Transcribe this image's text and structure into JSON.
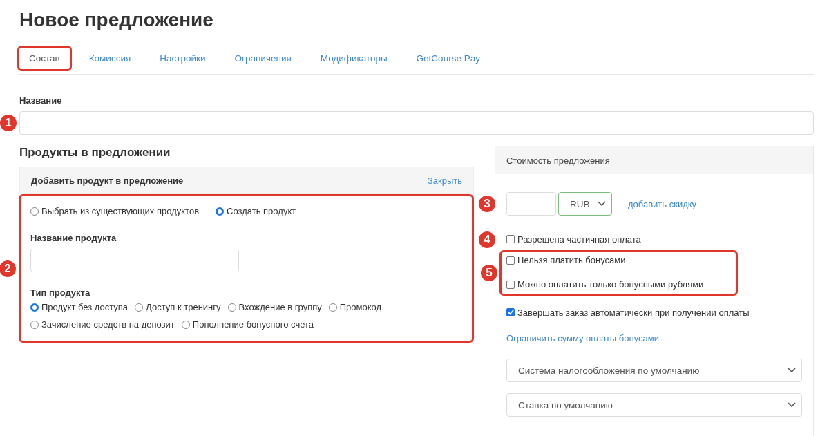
{
  "title": "Новое предложение",
  "tabs": [
    {
      "label": "Состав",
      "selected": true,
      "highlighted": true
    },
    {
      "label": "Комиссия",
      "selected": false,
      "highlighted": false
    },
    {
      "label": "Настройки",
      "selected": false,
      "highlighted": false
    },
    {
      "label": "Ограничения",
      "selected": false,
      "highlighted": false
    },
    {
      "label": "Модификаторы",
      "selected": false,
      "highlighted": false
    },
    {
      "label": "GetCourse Pay",
      "selected": false,
      "highlighted": false
    }
  ],
  "name_field": {
    "label": "Название",
    "marker": "1"
  },
  "products": {
    "heading": "Продукты в предложении",
    "panel_title": "Добавить продукт в предложение",
    "close_link": "Закрыть",
    "marker": "2",
    "highlighted": true,
    "source_options": [
      {
        "label": "Выбрать из существующих продуктов",
        "selected": false
      },
      {
        "label": "Создать продукт",
        "selected": true
      }
    ],
    "product_name_label": "Название продукта",
    "type_label": "Тип продукта",
    "type_options": [
      {
        "label": "Продукт без доступа",
        "selected": true
      },
      {
        "label": "Доступ к тренингу",
        "selected": false
      },
      {
        "label": "Вхождение в группу",
        "selected": false
      },
      {
        "label": "Промокод",
        "selected": false
      },
      {
        "label": "Зачисление средств на депозит",
        "selected": false
      },
      {
        "label": "Пополнение бонусного счета",
        "selected": false
      }
    ]
  },
  "price": {
    "title": "Стоимость предложения",
    "currency": "RUB",
    "marker": "3",
    "discount_link": "добавить скидку",
    "partial_payment": {
      "label": "Разрешена частичная оплата",
      "checked": false,
      "marker": "4"
    },
    "bonus_group": {
      "marker": "5",
      "highlighted": true,
      "options": [
        {
          "label": "Нельзя платить бонусами",
          "checked": false
        },
        {
          "label": "Можно оплатить только бонусными рублями",
          "checked": false
        }
      ]
    },
    "auto_complete": {
      "label": "Завершать заказ автоматически при получении оплаты",
      "checked": true
    },
    "limit_link": "Ограничить сумму оплаты бонусами",
    "selects": [
      "Система налогообложения по умолчанию",
      "Ставка по умолчанию"
    ]
  }
}
